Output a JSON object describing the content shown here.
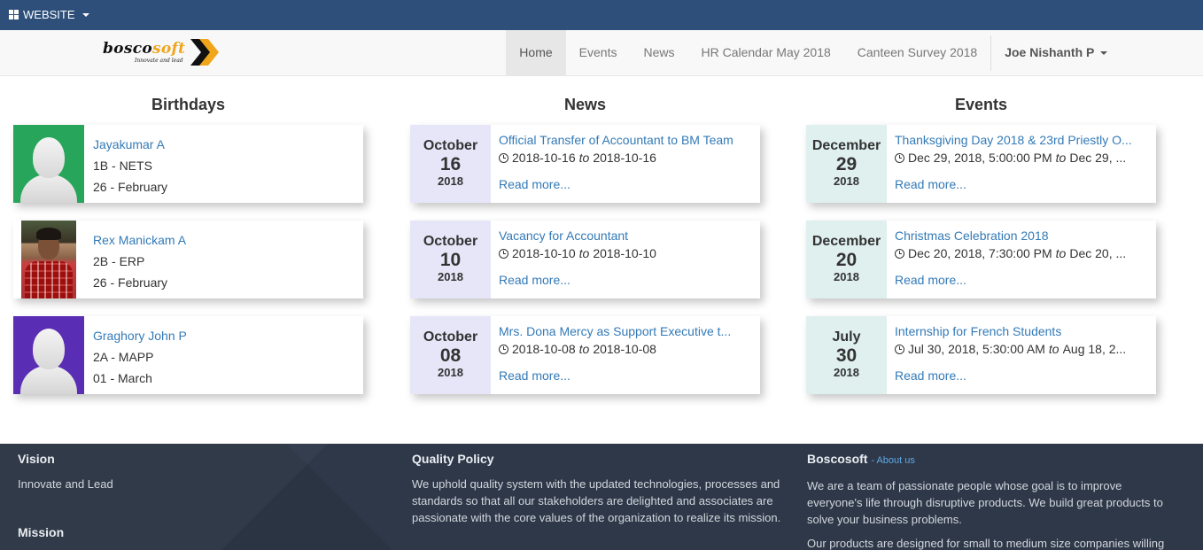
{
  "topbar": {
    "menu_label": "WEBSITE"
  },
  "logo": {
    "word_main": "bosco",
    "word_accent": "soft",
    "tagline": "Innovate and lead"
  },
  "nav": {
    "items": [
      "Home",
      "Events",
      "News",
      "HR Calendar May 2018",
      "Canteen Survey 2018"
    ],
    "active": "Home",
    "user": "Joe Nishanth P"
  },
  "birthdays": {
    "title": "Birthdays",
    "items": [
      {
        "name": "Jayakumar A",
        "team": "1B - NETS",
        "date": "26 - February",
        "avatar_bg": "#27a55a"
      },
      {
        "name": "Rex Manickam A",
        "team": "2B - ERP",
        "date": "26 - February",
        "avatar_bg": "photo"
      },
      {
        "name": "Graghory John P",
        "team": "2A - MAPP",
        "date": "01 - March",
        "avatar_bg": "#5a2db5"
      }
    ]
  },
  "news": {
    "title": "News",
    "items": [
      {
        "month": "October",
        "day": "16",
        "year": "2018",
        "title": "Official Transfer of Accountant to BM Team",
        "start": "2018-10-16",
        "end": "2018-10-16",
        "read_more": "Read more..."
      },
      {
        "month": "October",
        "day": "10",
        "year": "2018",
        "title": "Vacancy for Accountant",
        "start": "2018-10-10",
        "end": "2018-10-10",
        "read_more": "Read more..."
      },
      {
        "month": "October",
        "day": "08",
        "year": "2018",
        "title": "Mrs. Dona Mercy as Support Executive t...",
        "start": "2018-10-08",
        "end": "2018-10-08",
        "read_more": "Read more..."
      }
    ]
  },
  "events": {
    "title": "Events",
    "items": [
      {
        "month": "December",
        "day": "29",
        "year": "2018",
        "title": "Thanksgiving Day 2018 & 23rd Priestly O...",
        "start": "Dec 29, 2018, 5:00:00 PM",
        "end": "Dec 29, ...",
        "read_more": "Read more..."
      },
      {
        "month": "December",
        "day": "20",
        "year": "2018",
        "title": "Christmas Celebration 2018",
        "start": "Dec 20, 2018, 7:30:00 PM",
        "end": "Dec 20, ...",
        "read_more": "Read more..."
      },
      {
        "month": "July",
        "day": "30",
        "year": "2018",
        "title": "Internship for French Students",
        "start": "Jul 30, 2018, 5:30:00 AM",
        "end": "Aug 18, 2...",
        "read_more": "Read more..."
      }
    ]
  },
  "to_word": "to",
  "footer": {
    "vision_title": "Vision",
    "vision_text": "Innovate and Lead",
    "mission_title": "Mission",
    "quality_title": "Quality Policy",
    "quality_text": "We uphold quality system with the updated technologies, processes and standards so that all our stakeholders are delighted and associates are passionate with the core values of the organization to realize its mission.",
    "company_title": "Boscosoft",
    "about_link": "- About us",
    "company_text_1": "We are a team of passionate people whose goal is to improve everyone's life through disruptive products. We build great products to solve your business problems.",
    "company_text_2": "Our products are designed for small to medium size companies willing"
  }
}
